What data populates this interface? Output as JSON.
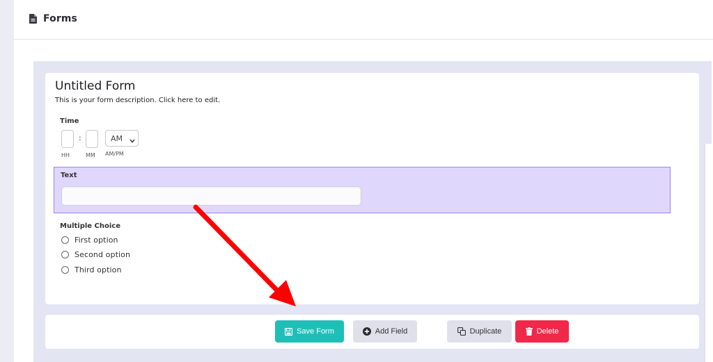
{
  "header": {
    "title": "Forms",
    "icon": "document-icon"
  },
  "form": {
    "title": "Untitled Form",
    "description": "This is your form description. Click here to edit."
  },
  "fields": {
    "time": {
      "label": "Time",
      "colon": ":",
      "hh_caption": "HH",
      "mm_caption": "MM",
      "ampm_value": "AM",
      "ampm_caption": "AM/PM"
    },
    "text": {
      "label": "Text",
      "value": ""
    },
    "multiple_choice": {
      "label": "Multiple Choice",
      "options": [
        "First option",
        "Second option",
        "Third option"
      ]
    }
  },
  "actions": {
    "save_label": "Save Form",
    "add_label": "Add Field",
    "duplicate_label": "Duplicate",
    "delete_label": "Delete"
  },
  "colors": {
    "save": "#1fbfb8",
    "delete": "#f0284a",
    "neutral_button": "#dfe0ea",
    "selected_field_bg": "#e0d7fd",
    "selected_field_border": "#9a82f0",
    "annotation_arrow": "#ff0000"
  }
}
